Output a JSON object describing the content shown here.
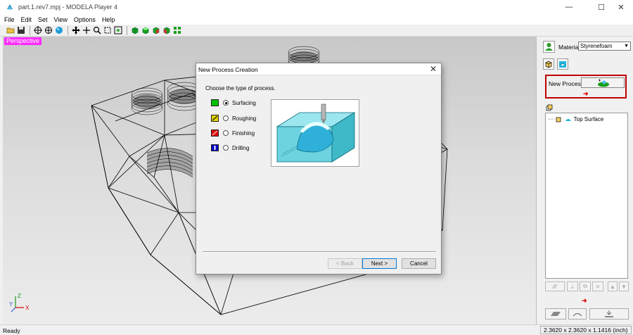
{
  "window": {
    "title": "part.1.rev7.mpj - MODELA Player 4",
    "minimize_glyph": "—",
    "maximize_glyph": "☐",
    "close_glyph": "✕"
  },
  "menu": [
    "File",
    "Edit",
    "Set",
    "View",
    "Options",
    "Help"
  ],
  "toolbar": {
    "icons": [
      "open-folder-icon",
      "save-icon",
      "view-center-icon",
      "view-crosshair-icon",
      "sphere-view-icon",
      "pan-icon",
      "move-icon",
      "zoom-icon",
      "fit-view-icon",
      "zoom-region-icon",
      "cube-front-icon",
      "cube-top-icon",
      "cube-side-icon",
      "cube-iso-icon",
      "grid-view-icon"
    ]
  },
  "viewport": {
    "label": "Perspective",
    "label_color": "#ff2aff",
    "axes": {
      "z": "Z",
      "y": "Y",
      "x": "X"
    }
  },
  "panel": {
    "material_label": "Material",
    "material_value": "Styrenefoam",
    "new_process_label": "New Process",
    "highlight_color": "#c00000",
    "arrow_color": "#e00000",
    "tree": {
      "items": [
        {
          "label": "Top Surface"
        }
      ]
    }
  },
  "dialog": {
    "title": "New Process Creation",
    "prompt": "Choose the type of process.",
    "options": [
      {
        "label": "Surfacing",
        "selected": true,
        "icon_color": "#00c000"
      },
      {
        "label": "Roughing",
        "selected": false,
        "icon_color": "#e0d000"
      },
      {
        "label": "Finishing",
        "selected": false,
        "icon_color": "#e00000"
      },
      {
        "label": "Drilling",
        "selected": false,
        "icon_color": "#0000c0"
      }
    ],
    "buttons": {
      "back": "< Back",
      "next": "Next >",
      "cancel": "Cancel"
    }
  },
  "status": {
    "text": "Ready",
    "dimensions": "2.3620 x 2.3620 x 1.1416 (inch)"
  }
}
